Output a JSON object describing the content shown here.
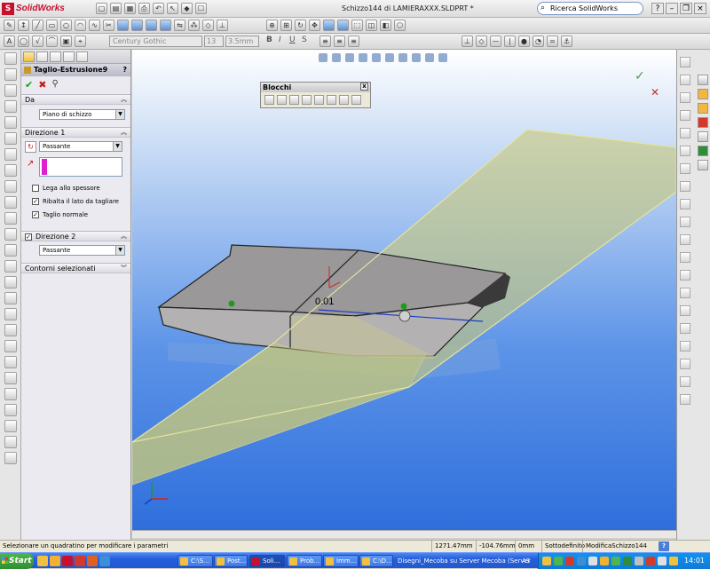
{
  "app": {
    "brand": "SolidWorks",
    "window_title": "Schizzo144 di LAMIERAXXX.SLDPRT *",
    "search_label": "Ricerca SolidWorks"
  },
  "format_toolbar": {
    "font": "Century Gothic",
    "size": "13",
    "height": "3.5mm"
  },
  "property_manager": {
    "title": "Taglio-Estrusione9",
    "help": "?",
    "from_section": {
      "header": "Da",
      "value": "Piano di schizzo"
    },
    "direction1": {
      "header": "Direzione 1",
      "end_condition": "Passante",
      "options": [
        {
          "label": "Lega allo spessore",
          "checked": false
        },
        {
          "label": "Ribalta il lato da tagliare",
          "checked": true
        },
        {
          "label": "Taglio normale",
          "checked": true
        }
      ]
    },
    "direction2": {
      "header": "Direzione 2",
      "checked": true,
      "end_condition": "Passante"
    },
    "contours": {
      "header": "Contorni selezionati"
    }
  },
  "blocchi_toolbar": {
    "title": "Blocchi",
    "close": "x"
  },
  "viewport": {
    "dimension": "0.01"
  },
  "status": {
    "message": "Selezionare un quadratino per modificare i parametri",
    "x": "1271.47mm",
    "y": "-104.76mm",
    "z": "0mm",
    "state": "Sottodefinito",
    "editing": "ModificaSchizzo144",
    "help": "?"
  },
  "taskbar": {
    "start": "Start",
    "buttons": [
      {
        "label": "C:\\S...",
        "active": false
      },
      {
        "label": "Post...",
        "active": false
      },
      {
        "label": "Soli...",
        "active": true
      },
      {
        "label": "Prob...",
        "active": false
      },
      {
        "label": "Imm...",
        "active": false
      },
      {
        "label": "C:\\D...",
        "active": false
      }
    ],
    "tray_text": "Disegni_Mecoba su Server Mecoba (Server",
    "tray_lang": "AS",
    "clock": "14:01"
  },
  "colors": {
    "viewport_top": "#ffffff",
    "viewport_bottom": "#2f6fdc",
    "plane_fill": "#c9c97a",
    "part_gray": "#9a9898",
    "taskbar": "#245edb",
    "start_green": "#2f8e2f"
  }
}
